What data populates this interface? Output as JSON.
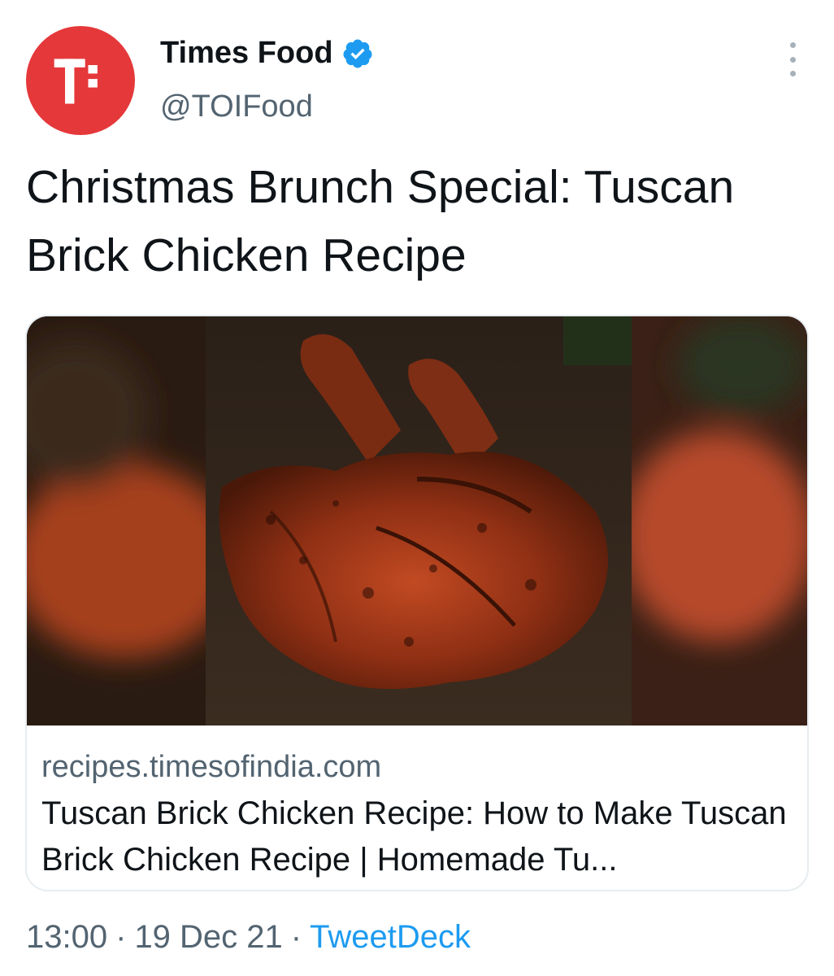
{
  "author": {
    "name": "Times Food",
    "handle": "@TOIFood",
    "verified": true
  },
  "tweet": {
    "text": "Christmas Brunch Special: Tuscan Brick Chicken Recipe"
  },
  "card": {
    "domain": "recipes.timesofindia.com",
    "title": "Tuscan Brick Chicken Recipe: How to Make Tuscan Brick Chicken Recipe | Homemade Tu..."
  },
  "footer": {
    "time": "13:00",
    "date": "19 Dec 21",
    "source": "TweetDeck",
    "separator": "·"
  },
  "colors": {
    "brand_red": "#e5383b",
    "verified_blue": "#1d9bf0",
    "link_blue": "#1d9bf0",
    "secondary_text": "#536471"
  },
  "icons": {
    "avatar": "times-food-logo",
    "verified": "verified-badge-icon",
    "more": "more-options-icon"
  }
}
